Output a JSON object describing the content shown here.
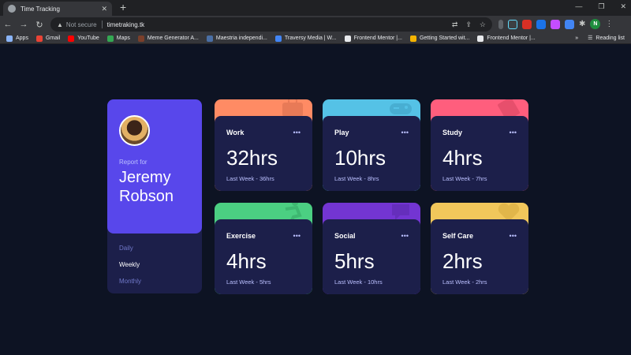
{
  "browser": {
    "tab_title": "Time Tracking",
    "url_not_secure": "Not secure",
    "url": "timetraking.tk",
    "profile_initial": "N",
    "bookmarks": [
      {
        "label": "Apps",
        "color": "#8ab4f8"
      },
      {
        "label": "Gmail",
        "color": "#ea4335"
      },
      {
        "label": "YouTube",
        "color": "#ff0000"
      },
      {
        "label": "Maps",
        "color": "#34a853"
      },
      {
        "label": "Meme Generator A...",
        "color": "#7b3f2a"
      },
      {
        "label": "Maestria independi...",
        "color": "#4a6fa5"
      },
      {
        "label": "Traversy Media | W...",
        "color": "#4285f4"
      },
      {
        "label": "Frontend Mentor |...",
        "color": "#e8eaed"
      },
      {
        "label": "Getting Started wit...",
        "color": "#f4b400"
      },
      {
        "label": "Frontend Mentor |...",
        "color": "#e8eaed"
      }
    ],
    "reading_list": "Reading list"
  },
  "profile": {
    "report_for": "Report for",
    "first_name": "Jeremy",
    "last_name": "Robson",
    "timeframes": [
      {
        "label": "Daily",
        "active": false
      },
      {
        "label": "Weekly",
        "active": true
      },
      {
        "label": "Monthly",
        "active": false
      }
    ]
  },
  "cards": [
    {
      "title": "Work",
      "current": "32hrs",
      "previous": "Last Week - 36hrs",
      "accent": "#ff8b64",
      "icon": "briefcase-icon"
    },
    {
      "title": "Play",
      "current": "10hrs",
      "previous": "Last Week - 8hrs",
      "accent": "#55c2e6",
      "icon": "gamepad-icon"
    },
    {
      "title": "Study",
      "current": "4hrs",
      "previous": "Last Week - 7hrs",
      "accent": "#ff5e7d",
      "icon": "book-icon"
    },
    {
      "title": "Exercise",
      "current": "4hrs",
      "previous": "Last Week - 5hrs",
      "accent": "#4bcf82",
      "icon": "running-icon"
    },
    {
      "title": "Social",
      "current": "5hrs",
      "previous": "Last Week - 10hrs",
      "accent": "#7335d2",
      "icon": "chat-icon"
    },
    {
      "title": "Self Care",
      "current": "2hrs",
      "previous": "Last Week - 2hrs",
      "accent": "#f1c75b",
      "icon": "heart-icon"
    }
  ],
  "card_menu_glyph": "•••"
}
